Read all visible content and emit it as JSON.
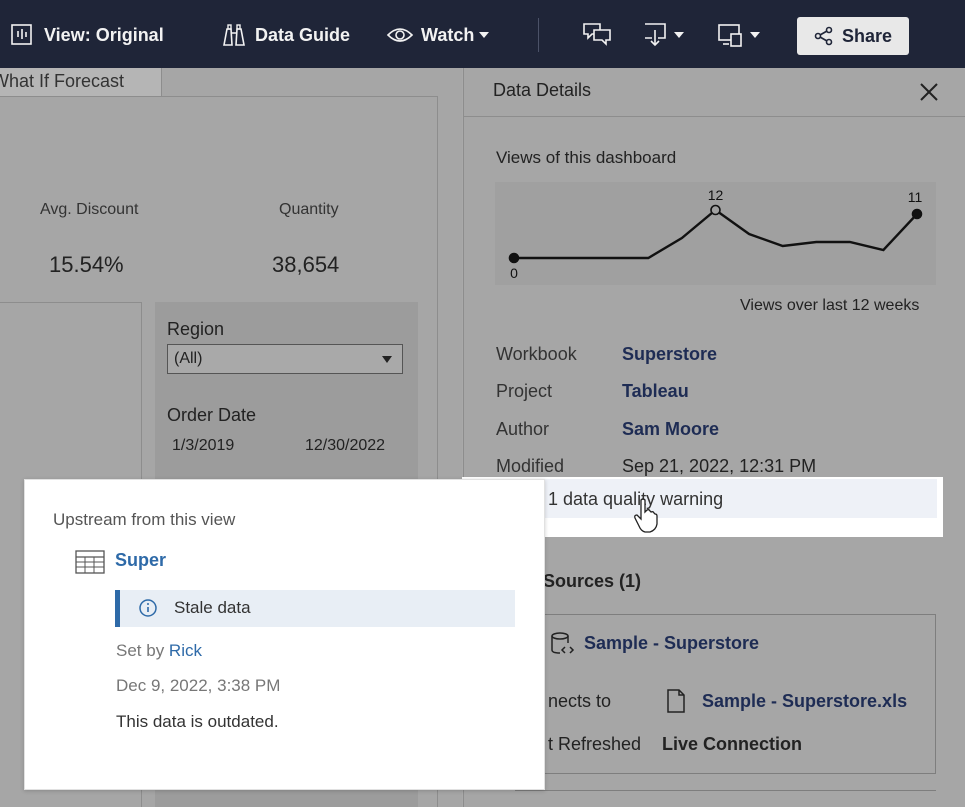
{
  "toolbar": {
    "view_label": "View: Original",
    "data_guide_label": "Data Guide",
    "watch_label": "Watch",
    "share_label": "Share"
  },
  "dashboard": {
    "tab_label": "What If Forecast",
    "kpis": [
      {
        "label": "Avg. Discount",
        "value": "15.54%"
      },
      {
        "label": "Quantity",
        "value": "38,654"
      }
    ],
    "filters": {
      "region_label": "Region",
      "region_value": "(All)",
      "order_date_label": "Order Date",
      "date_start": "1/3/2019",
      "date_end": "12/30/2022"
    }
  },
  "details_panel": {
    "title": "Data Details",
    "views_heading": "Views of this dashboard",
    "chart_caption": "Views over last 12 weeks",
    "workbook_label": "Workbook",
    "workbook_value": "Superstore",
    "project_label": "Project",
    "project_value": "Tableau",
    "author_label": "Author",
    "author_value": "Sam Moore",
    "modified_label": "Modified",
    "modified_value": "Sep 21, 2022, 12:31 PM",
    "warning_text": "1 data quality warning",
    "sources_title": "Sources (1)",
    "source_name": "Sample - Superstore",
    "connects_label": "nects to",
    "connects_value": "Sample - Superstore.xls",
    "refreshed_label": "t Refreshed",
    "refreshed_value": "Live Connection"
  },
  "chart_data": {
    "type": "line",
    "x": [
      1,
      2,
      3,
      4,
      5,
      6,
      7,
      8,
      9,
      10,
      11,
      12
    ],
    "values": [
      0,
      0,
      0,
      0,
      0,
      5,
      12,
      6,
      3,
      4,
      4,
      2,
      11
    ],
    "labels": {
      "start": "0",
      "peak": "12",
      "end": "11"
    }
  },
  "popup": {
    "heading": "Upstream from this view",
    "asset_name": "Super",
    "warning_label": "Stale data",
    "set_by_prefix": "Set by ",
    "set_by_user": "Rick",
    "date": "Dec 9, 2022, 3:38 PM",
    "message": "This data is outdated."
  }
}
